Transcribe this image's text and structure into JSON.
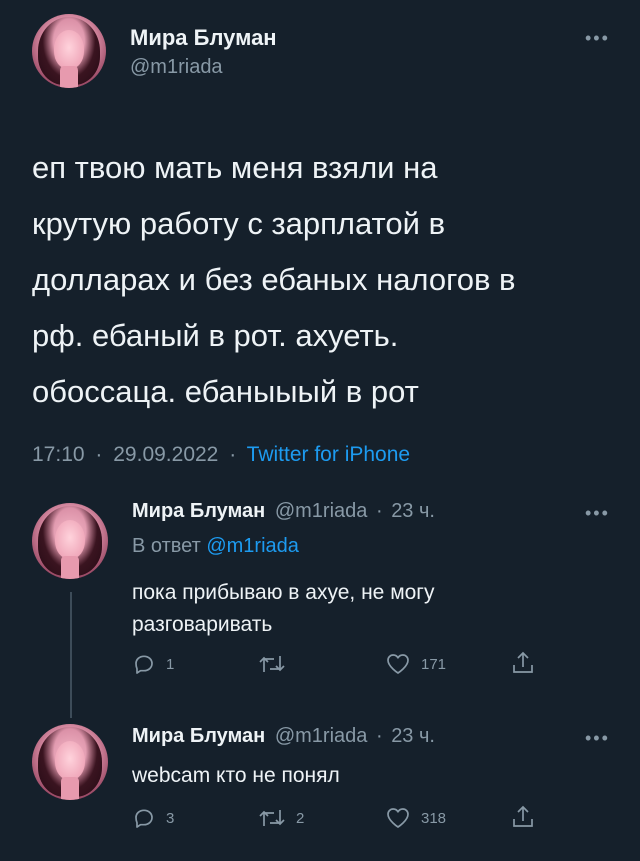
{
  "main_tweet": {
    "display_name": "Мира Блуман",
    "handle": "@m1riada",
    "text_lines": [
      "еп твою мать меня взяли на",
      "крутую работу с зарплатой в",
      "долларах и без ебаных налогов в",
      "рф. ебаный в рот. ахуеть.",
      "обоссаца. ебаныыый в рот"
    ],
    "time": "17:10",
    "date": "29.09.2022",
    "separator": "·",
    "source": "Twitter for iPhone",
    "more_icon": "more-horizontal-icon"
  },
  "replies": [
    {
      "display_name": "Мира Блуман",
      "handle": "@m1riada",
      "age": "23 ч.",
      "reply_to_prefix": "В ответ",
      "reply_to_handle": "@m1riada",
      "text_lines": [
        "пока прибываю в ахуе, не могу",
        "разговаривать"
      ],
      "reply_count": "1",
      "retweet_count": "",
      "like_count": "171"
    },
    {
      "display_name": "Мира Блуман",
      "handle": "@m1riada",
      "age": "23 ч.",
      "text_lines": [
        "webcam кто не понял"
      ],
      "reply_count": "3",
      "retweet_count": "2",
      "like_count": "318"
    }
  ],
  "colors": {
    "background": "#15202b",
    "text": "#e9eef2",
    "muted": "#8899a6",
    "link": "#1d9bf0"
  }
}
